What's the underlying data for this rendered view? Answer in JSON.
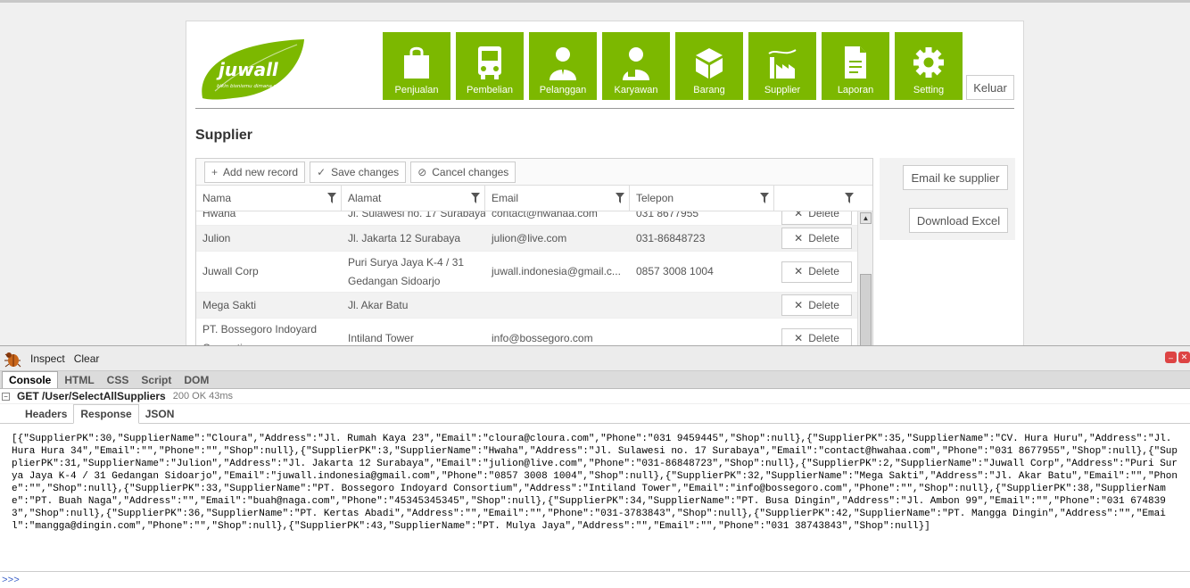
{
  "app": {
    "brand": "juwall",
    "tagline": "bikin bisnismu dimana saja",
    "logout": "Keluar",
    "nav": [
      {
        "label": "Penjualan",
        "icon": "shopping-bag-icon"
      },
      {
        "label": "Pembelian",
        "icon": "truck-icon"
      },
      {
        "label": "Pelanggan",
        "icon": "customer-icon"
      },
      {
        "label": "Karyawan",
        "icon": "employee-icon"
      },
      {
        "label": "Barang",
        "icon": "box-icon"
      },
      {
        "label": "Supplier",
        "icon": "factory-icon"
      },
      {
        "label": "Laporan",
        "icon": "report-icon"
      },
      {
        "label": "Setting",
        "icon": "gear-icon"
      }
    ],
    "page_title": "Supplier",
    "toolbar": {
      "add": "Add new record",
      "save": "Save changes",
      "cancel": "Cancel changes"
    },
    "columns": [
      "Nama",
      "Alamat",
      "Email",
      "Telepon"
    ],
    "rows": [
      {
        "nama": "Hwaha",
        "alamat": "Jl. Sulawesi no. 17 Surabaya",
        "email": "contact@hwahaa.com",
        "telepon": "031 8677955"
      },
      {
        "nama": "Julion",
        "alamat": "Jl. Jakarta 12 Surabaya",
        "email": "julion@live.com",
        "telepon": "031-86848723"
      },
      {
        "nama": "Juwall Corp",
        "alamat": "Puri Surya Jaya K-4 / 31 Gedangan Sidoarjo",
        "email": "juwall.indonesia@gmail.c...",
        "telepon": "0857 3008 1004"
      },
      {
        "nama": "Mega Sakti",
        "alamat": "Jl. Akar Batu",
        "email": "",
        "telepon": ""
      },
      {
        "nama": "PT. Bossegoro Indoyard Consortium",
        "alamat": "Intiland Tower",
        "email": "info@bossegoro.com",
        "telepon": ""
      }
    ],
    "delete_label": "Delete",
    "side": {
      "email_supplier": "Email ke supplier",
      "download_excel": "Download Excel"
    }
  },
  "firebug": {
    "inspect": "Inspect",
    "clear": "Clear",
    "tabs": [
      "Console",
      "HTML",
      "CSS",
      "Script",
      "DOM"
    ],
    "request": {
      "method_url": "GET /User/SelectAllSuppliers",
      "status": "200 OK 43ms"
    },
    "subtabs": [
      "Headers",
      "Response",
      "JSON"
    ],
    "response": "[{\"SupplierPK\":30,\"SupplierName\":\"Cloura\",\"Address\":\"Jl. Rumah Kaya 23\",\"Email\":\"cloura@cloura.com\",\"Phone\":\"031 9459445\",\"Shop\":null},{\"SupplierPK\":35,\"SupplierName\":\"CV. Hura Huru\",\"Address\":\"Jl. Hura Hura 34\",\"Email\":\"\",\"Phone\":\"\",\"Shop\":null},{\"SupplierPK\":3,\"SupplierName\":\"Hwaha\",\"Address\":\"Jl. Sulawesi no. 17 Surabaya\",\"Email\":\"contact@hwahaa.com\",\"Phone\":\"031 8677955\",\"Shop\":null},{\"SupplierPK\":31,\"SupplierName\":\"Julion\",\"Address\":\"Jl. Jakarta 12 Surabaya\",\"Email\":\"julion@live.com\",\"Phone\":\"031-86848723\",\"Shop\":null},{\"SupplierPK\":2,\"SupplierName\":\"Juwall Corp\",\"Address\":\"Puri Surya Jaya K-4 / 31 Gedangan Sidoarjo\",\"Email\":\"juwall.indonesia@gmail.com\",\"Phone\":\"0857 3008 1004\",\"Shop\":null},{\"SupplierPK\":32,\"SupplierName\":\"Mega Sakti\",\"Address\":\"Jl. Akar Batu\",\"Email\":\"\",\"Phone\":\"\",\"Shop\":null},{\"SupplierPK\":33,\"SupplierName\":\"PT. Bossegoro Indoyard Consortium\",\"Address\":\"Intiland Tower\",\"Email\":\"info@bossegoro.com\",\"Phone\":\"\",\"Shop\":null},{\"SupplierPK\":38,\"SupplierName\":\"PT. Buah Naga\",\"Address\":\"\",\"Email\":\"buah@naga.com\",\"Phone\":\"45345345345\",\"Shop\":null},{\"SupplierPK\":34,\"SupplierName\":\"PT. Busa Dingin\",\"Address\":\"Jl. Ambon 99\",\"Email\":\"\",\"Phone\":\"031 6748393\",\"Shop\":null},{\"SupplierPK\":36,\"SupplierName\":\"PT. Kertas Abadi\",\"Address\":\"\",\"Email\":\"\",\"Phone\":\"031-3783843\",\"Shop\":null},{\"SupplierPK\":42,\"SupplierName\":\"PT. Mangga Dingin\",\"Address\":\"\",\"Email\":\"mangga@dingin.com\",\"Phone\":\"\",\"Shop\":null},{\"SupplierPK\":43,\"SupplierName\":\"PT. Mulya Jaya\",\"Address\":\"\",\"Email\":\"\",\"Phone\":\"031 38743843\",\"Shop\":null}]",
    "prompt": ">>>"
  },
  "colors": {
    "accent": "#7cb800",
    "firebug_prompt": "#3b60c8"
  }
}
